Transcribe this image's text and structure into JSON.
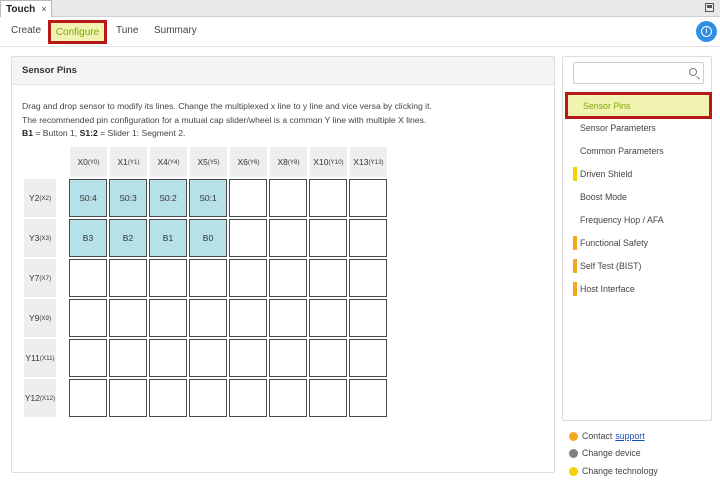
{
  "tab": {
    "label": "Touch",
    "close": "×"
  },
  "nav": {
    "items": [
      "Create",
      "Configure",
      "Tune",
      "Summary"
    ],
    "active": "Configure",
    "info_icon": "info-icon"
  },
  "panel": {
    "title": "Sensor Pins",
    "desc_line1": "Drag and drop sensor to modify its lines. Change the multiplexed x line to y line and vice versa by clicking it.",
    "desc_line2": "The recommended pin configuration for a mutual cap slider/wheel is a common Y line with multiple X lines.",
    "desc_b1": "B1",
    "desc_mid": " = Button 1, ",
    "desc_s12": "S1:2",
    "desc_end": " = Slider 1: Segment 2."
  },
  "grid": {
    "columns": [
      {
        "main": "X0",
        "sub": "(Y0)"
      },
      {
        "main": "X1",
        "sub": "(Y1)"
      },
      {
        "main": "X4",
        "sub": "(Y4)"
      },
      {
        "main": "X5",
        "sub": "(Y5)"
      },
      {
        "main": "X6",
        "sub": "(Y6)"
      },
      {
        "main": "X8",
        "sub": "(Y8)"
      },
      {
        "main": "X10",
        "sub": "(Y10)"
      },
      {
        "main": "X13",
        "sub": "(Y13)"
      }
    ],
    "rows": [
      {
        "main": "Y2",
        "sub": "(X2)",
        "cells": [
          "S0:4",
          "S0:3",
          "S0:2",
          "S0:1",
          "",
          "",
          "",
          ""
        ]
      },
      {
        "main": "Y3",
        "sub": "(X3)",
        "cells": [
          "B3",
          "B2",
          "B1",
          "B0",
          "",
          "",
          "",
          ""
        ]
      },
      {
        "main": "Y7",
        "sub": "(X7)",
        "cells": [
          "",
          "",
          "",
          "",
          "",
          "",
          "",
          ""
        ]
      },
      {
        "main": "Y9",
        "sub": "(X9)",
        "cells": [
          "",
          "",
          "",
          "",
          "",
          "",
          "",
          ""
        ]
      },
      {
        "main": "Y11",
        "sub": "(X11)",
        "cells": [
          "",
          "",
          "",
          "",
          "",
          "",
          "",
          ""
        ]
      },
      {
        "main": "Y12",
        "sub": "(X12)",
        "cells": [
          "",
          "",
          "",
          "",
          "",
          "",
          "",
          ""
        ]
      }
    ],
    "filled_color": "#b7e1e8"
  },
  "side": {
    "search_placeholder": "",
    "active": "Sensor Pins",
    "items": [
      {
        "label": "Sensor Parameters",
        "marker": ""
      },
      {
        "label": "Common Parameters",
        "marker": ""
      },
      {
        "label": "Driven Shield",
        "marker": "#f5d300"
      },
      {
        "label": "Boost Mode",
        "marker": ""
      },
      {
        "label": "Frequency Hop / AFA",
        "marker": ""
      },
      {
        "label": "Functional Safety",
        "marker": "#f5a623"
      },
      {
        "label": "Self Test (BIST)",
        "marker": "#f5a623"
      },
      {
        "label": "Host Interface",
        "marker": "#f5a623"
      }
    ]
  },
  "footer": {
    "contact_label": "Contact",
    "contact_link": "support",
    "change_device": "Change device",
    "change_technology": "Change technology",
    "colors": {
      "contact": "#f5a623",
      "device": "#808080",
      "technology": "#f5d300"
    }
  },
  "colors": {
    "accent_highlight": "#f0f4b0",
    "active_text": "#7ea60c",
    "highlight_border": "#b81818",
    "info_button": "#2f8fe3"
  }
}
